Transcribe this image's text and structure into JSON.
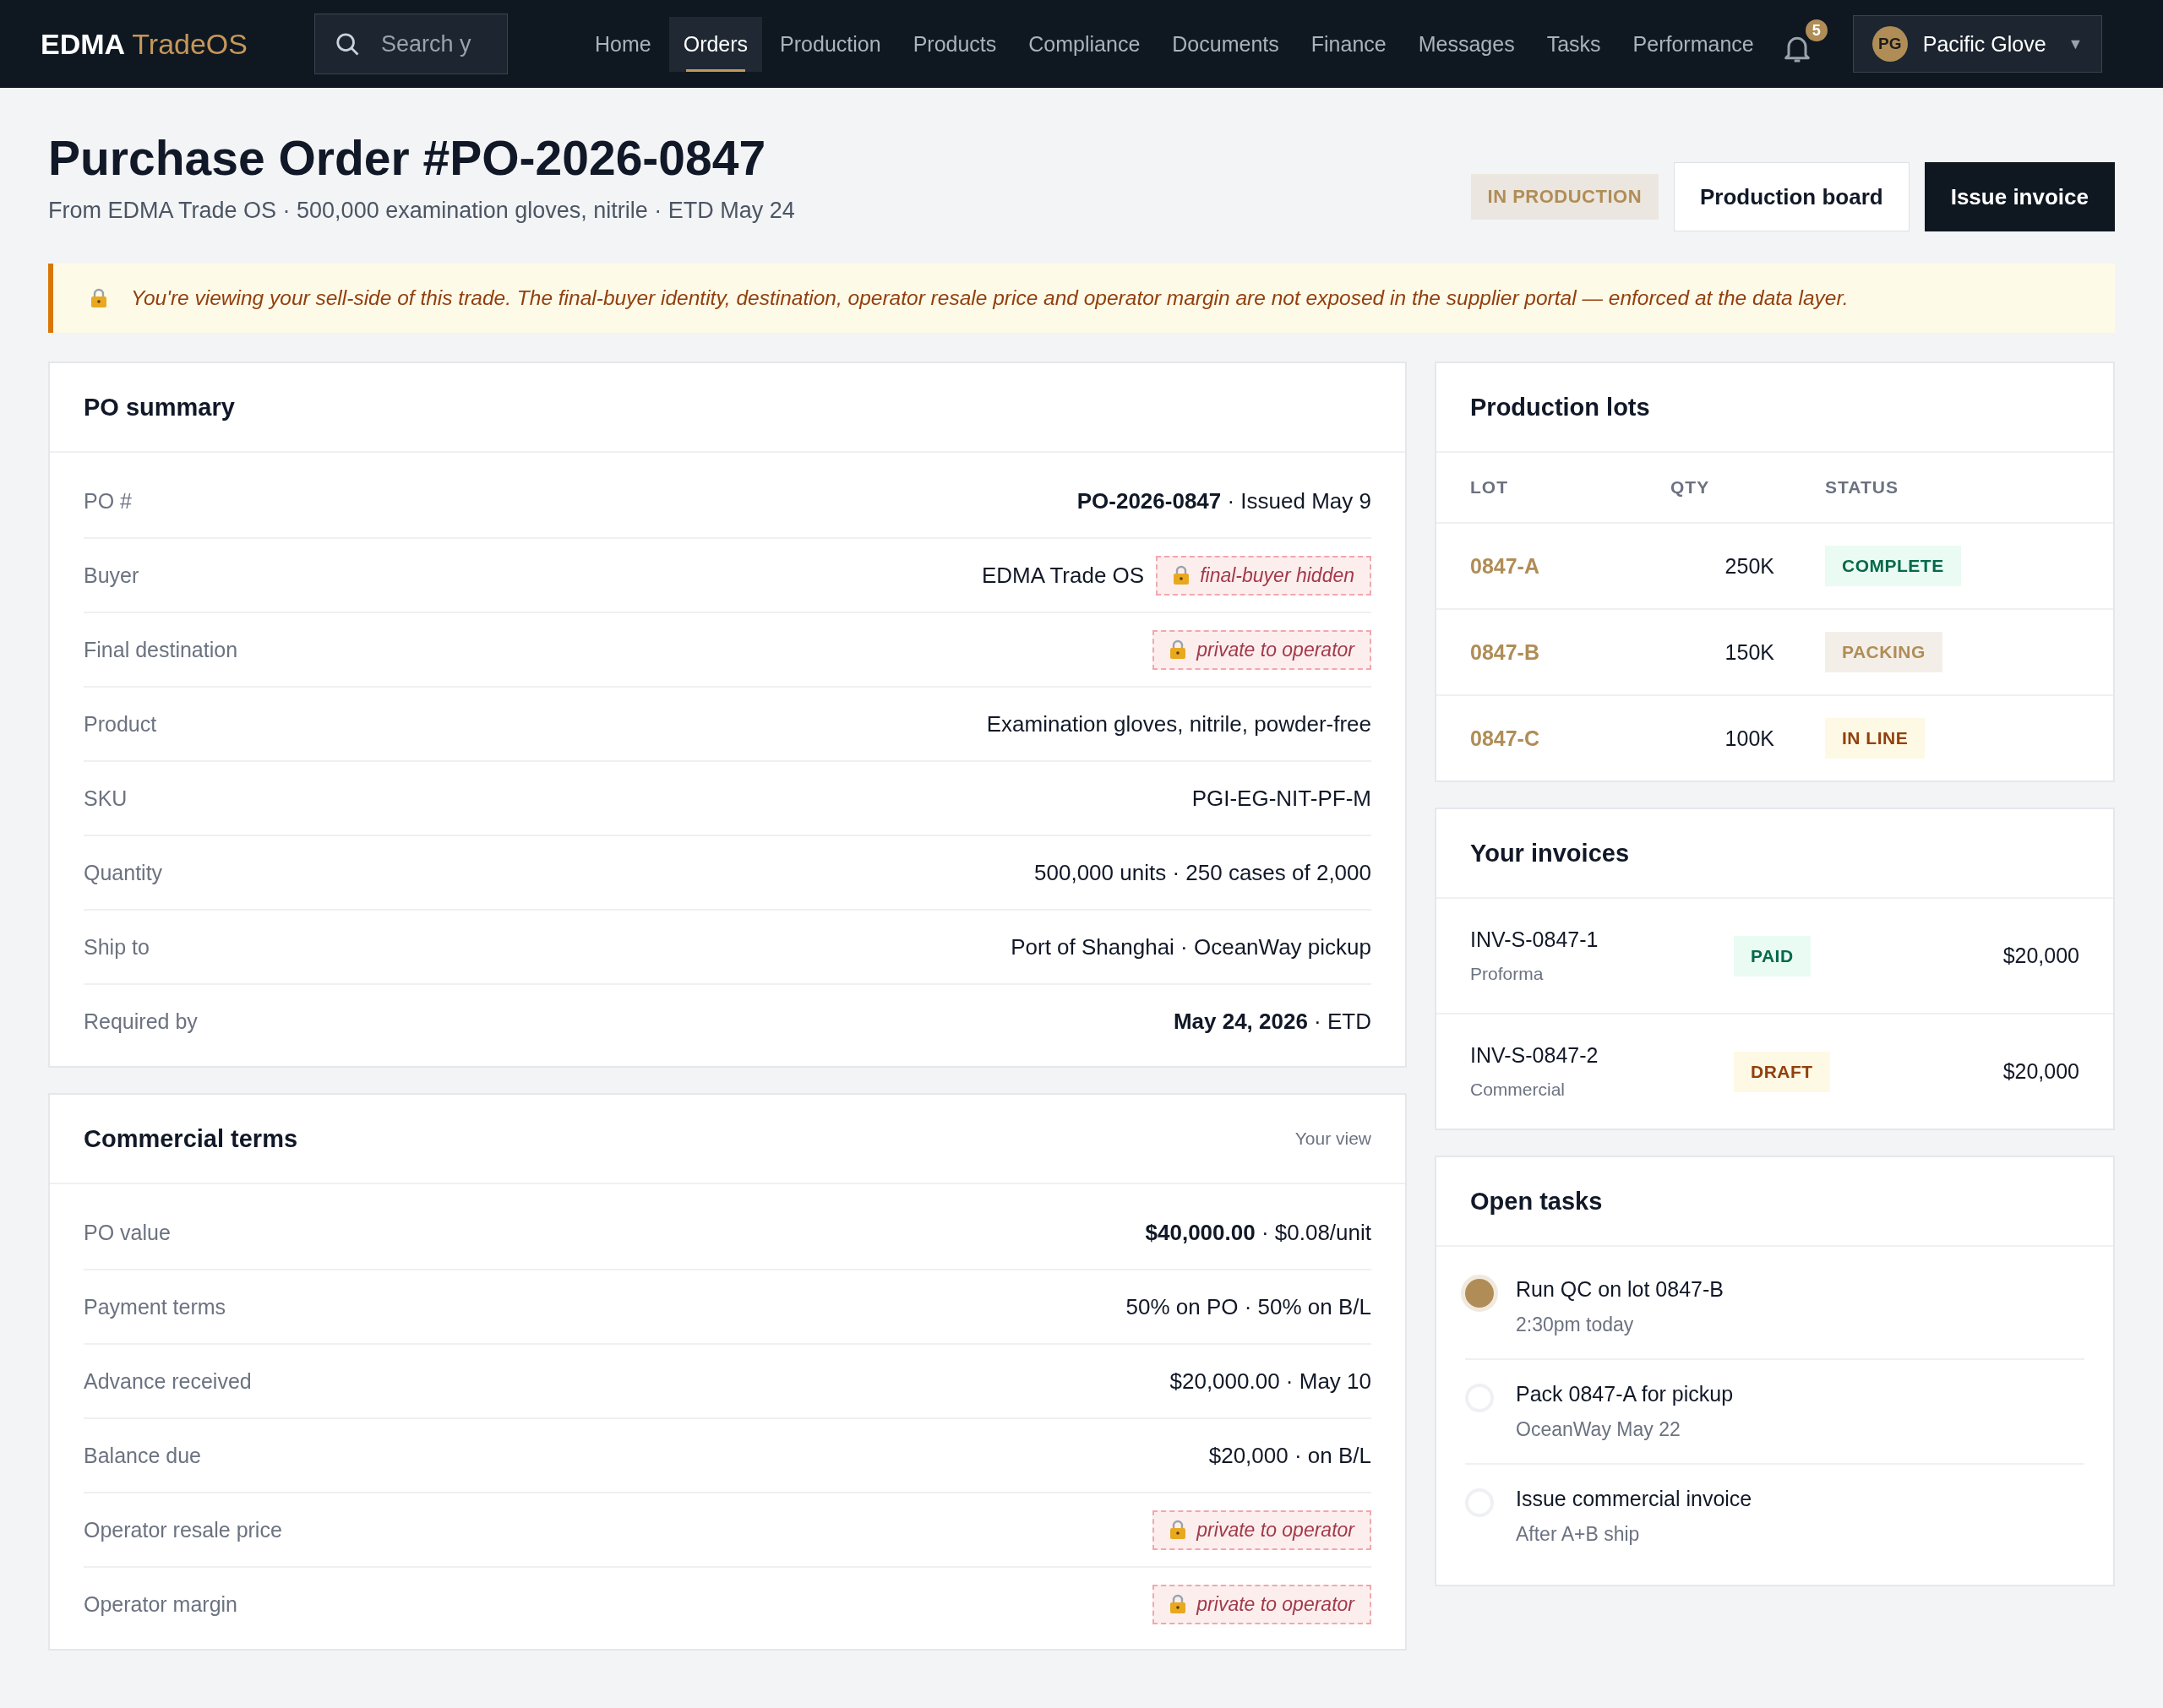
{
  "nav": {
    "brand_main": "EDMA",
    "brand_accent": "TradeOS",
    "search": {
      "placeholder": "Search y"
    },
    "items": [
      {
        "label": "Home",
        "selected": false
      },
      {
        "label": "Orders",
        "selected": true
      },
      {
        "label": "Production",
        "selected": false
      },
      {
        "label": "Products",
        "selected": false
      },
      {
        "label": "Compliance",
        "selected": false
      },
      {
        "label": "Documents",
        "selected": false
      },
      {
        "label": "Finance",
        "selected": false
      },
      {
        "label": "Messages",
        "selected": false
      },
      {
        "label": "Tasks",
        "selected": false
      },
      {
        "label": "Performance",
        "selected": false
      }
    ],
    "notifications": "5",
    "user": {
      "initials": "PG",
      "name": "Pacific Glove",
      "caret": "▼"
    }
  },
  "header": {
    "title": "Purchase Order #PO-2026-0847",
    "subtitle": "From EDMA Trade OS · 500,000 examination gloves, nitrile · ETD May 24",
    "status": "IN PRODUCTION",
    "buttons": [
      {
        "label": "Production board",
        "kind": "secondary"
      },
      {
        "label": "Issue invoice",
        "kind": "primary"
      }
    ]
  },
  "notice": "You're viewing your sell-side of this trade. The final-buyer identity, destination, operator resale price and operator margin are not exposed in the supplier portal — enforced at the data layer.",
  "po_summary": {
    "title": "PO summary",
    "rows": [
      {
        "label": "PO #",
        "value": "**PO-2026-0847** · Issued May 9"
      },
      {
        "label": "Buyer",
        "value": "EDMA Trade OS",
        "chip": "final-buyer hidden"
      },
      {
        "label": "Final destination",
        "chip": "private to operator"
      },
      {
        "label": "Product",
        "value": "Examination gloves, nitrile, powder-free"
      },
      {
        "label": "SKU",
        "value": "PGI-EG-NIT-PF-M"
      },
      {
        "label": "Quantity",
        "value": "500,000 units · 250 cases of 2,000"
      },
      {
        "label": "Ship to",
        "value": "Port of Shanghai · OceanWay pickup"
      },
      {
        "label": "Required by",
        "value": "**May 24, 2026** · ETD"
      }
    ]
  },
  "commercial_terms": {
    "title": "Commercial terms",
    "note": "Your view",
    "rows": [
      {
        "label": "PO value",
        "value": "**$40,000.00** · $0.08/unit"
      },
      {
        "label": "Payment terms",
        "value": "50% on PO · 50% on B/L"
      },
      {
        "label": "Advance received",
        "value": "$20,000.00 · May 10"
      },
      {
        "label": "Balance due",
        "value": "$20,000 · on B/L"
      },
      {
        "label": "Operator resale price",
        "chip": "private to operator"
      },
      {
        "label": "Operator margin",
        "chip": "private to operator"
      }
    ]
  },
  "production_lots": {
    "title": "Production lots",
    "columns": [
      "LOT",
      "QTY",
      "STATUS"
    ],
    "rows": [
      {
        "lot": "0847-A",
        "qty": "250K",
        "status": "COMPLETE",
        "kind": "complete"
      },
      {
        "lot": "0847-B",
        "qty": "150K",
        "status": "PACKING",
        "kind": "packing"
      },
      {
        "lot": "0847-C",
        "qty": "100K",
        "status": "IN LINE",
        "kind": "inline"
      }
    ]
  },
  "invoices": {
    "title": "Your invoices",
    "rows": [
      {
        "number": "INV-S-0847-1",
        "type": "Proforma",
        "status": "PAID",
        "kind": "paid",
        "amount": "$20,000"
      },
      {
        "number": "INV-S-0847-2",
        "type": "Commercial",
        "status": "DRAFT",
        "kind": "draft",
        "amount": "$20,000"
      }
    ]
  },
  "tasks": {
    "title": "Open tasks",
    "items": [
      {
        "title": "Run QC on lot 0847-B",
        "meta": "2:30pm today",
        "active": true
      },
      {
        "title": "Pack 0847-A for pickup",
        "meta": "OceanWay May 22",
        "active": false
      },
      {
        "title": "Issue commercial invoice",
        "meta": "After A+B ship",
        "active": false
      }
    ]
  }
}
